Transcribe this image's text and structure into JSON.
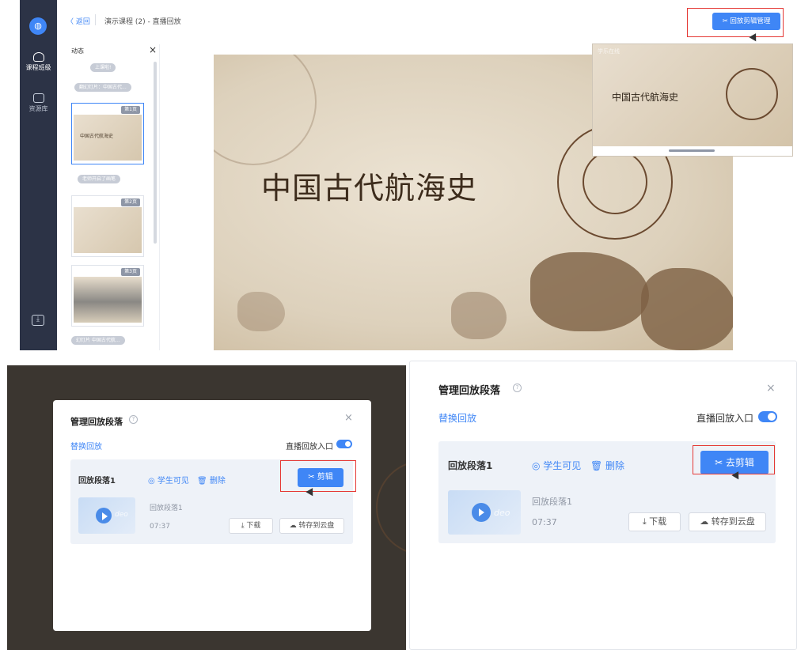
{
  "app": {
    "sidebar": {
      "logo_text": "◍",
      "items": [
        {
          "label": "课程班级",
          "icon": "class-icon"
        },
        {
          "label": "资源库",
          "icon": "resource-icon"
        }
      ],
      "bottom_icon": "download-icon"
    },
    "topbar": {
      "back_label": "〈 返回",
      "breadcrumb": "演示课程 (2) - 直播回放",
      "manage_button": "✂ 回放剪辑管理"
    },
    "timeline": {
      "header": "动态",
      "close": "×",
      "events": [
        "上课啦!",
        "翻幻灯片：中国古代...",
        "老师开启了画笔",
        "幻灯片 中国古代航..."
      ],
      "slides": [
        {
          "page": "第1页",
          "thumb_title": "中国古代航海史"
        },
        {
          "page": "第2页",
          "thumb_title": ""
        },
        {
          "page": "第3页",
          "thumb_title": ""
        }
      ]
    },
    "slide": {
      "title": "中国古代航海史"
    },
    "pip": {
      "logo": "学乐在线",
      "title": "中国古代航海史"
    }
  },
  "dialog_left": {
    "title": "管理回放段落",
    "help": "?",
    "close": "×",
    "replace_link": "替换回放",
    "entry_label": "直播回放入口",
    "segment": {
      "name": "回放段落1",
      "visible_label": "◎ 学生可见",
      "delete_label": "🗑 删除",
      "clip_button": "✂ 剪辑",
      "video_label": "deo",
      "sub_name": "回放段落1",
      "duration": "07:37",
      "download_button": "⤓ 下载",
      "cloud_button": "☁ 转存到云盘"
    }
  },
  "dialog_right": {
    "title": "管理回放段落",
    "help": "?",
    "close": "×",
    "replace_link": "替换回放",
    "entry_label": "直播回放入口",
    "segment": {
      "name": "回放段落1",
      "visible_label": "◎ 学生可见",
      "delete_label": "🗑 删除",
      "clip_button": "✂ 去剪辑",
      "video_label": "deo",
      "sub_name": "回放段落1",
      "duration": "07:37",
      "download_button": "⤓ 下载",
      "cloud_button": "☁ 转存到云盘"
    }
  },
  "colors": {
    "accent": "#3f86f6",
    "sidebar_bg": "#2c3346",
    "highlight_box": "#e53935"
  }
}
